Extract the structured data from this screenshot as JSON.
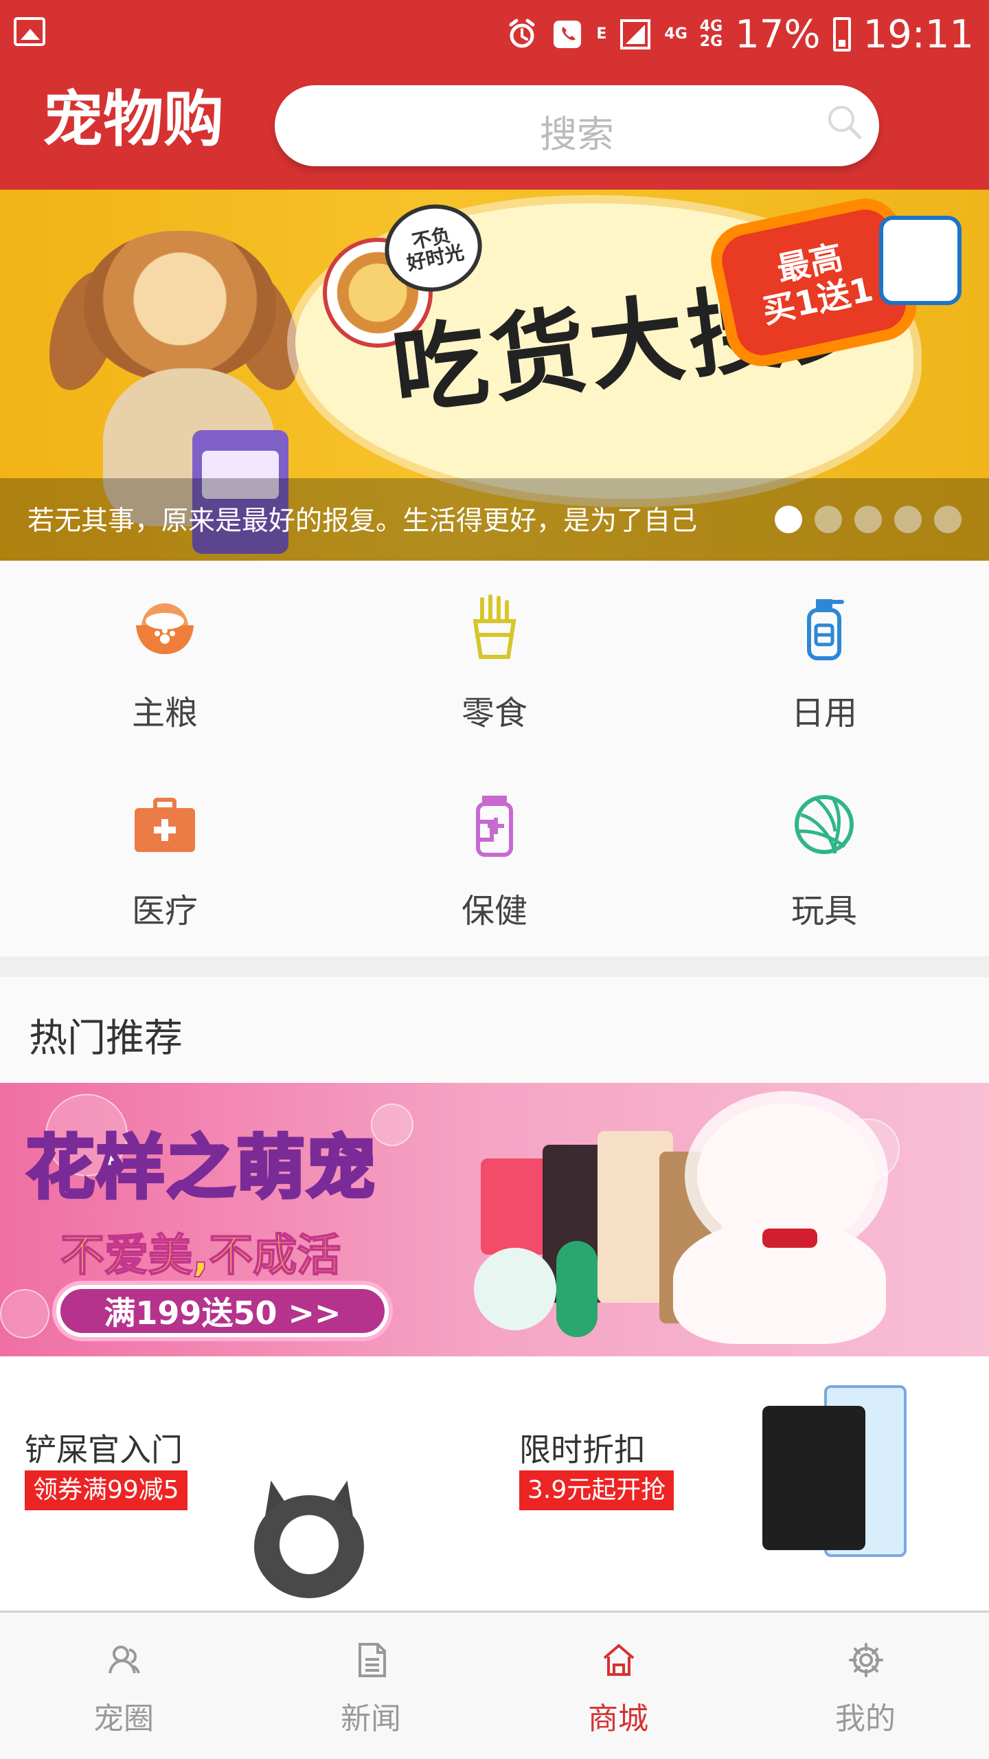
{
  "status_bar": {
    "network_1": "E",
    "network_2": "4G",
    "network_3": "4G",
    "network_4": "2G",
    "battery": "17%",
    "time": "19:11"
  },
  "header": {
    "title": "宠物购",
    "search_placeholder": "搜索"
  },
  "banner": {
    "tag": "不负\n好时光",
    "title": "吃货大搜罗",
    "badge": "最高\n买1送1",
    "caption": "若无其事，原来是最好的报复。生活得更好，是为了自己",
    "dots": [
      "active",
      "inactive",
      "inactive",
      "inactive",
      "inactive"
    ]
  },
  "categories": [
    {
      "label": "主粮",
      "icon": "food-bowl-icon",
      "color": "#ef7e3b"
    },
    {
      "label": "零食",
      "icon": "fries-icon",
      "color": "#d7c62b"
    },
    {
      "label": "日用",
      "icon": "bottle-icon",
      "color": "#2e87d6"
    },
    {
      "label": "医疗",
      "icon": "medical-kit-icon",
      "color": "#eb7c45"
    },
    {
      "label": "保健",
      "icon": "supplement-icon",
      "color": "#c66ad0"
    },
    {
      "label": "玩具",
      "icon": "ball-icon",
      "color": "#30b58a"
    }
  ],
  "hot": {
    "title": "热门推荐",
    "banner_title": "花样之萌宠",
    "banner_subtitle": "不爱美,不成活",
    "banner_button": "满199送50 >>"
  },
  "promos": [
    {
      "title": "铲屎官入门",
      "tag": "领券满99减5"
    },
    {
      "title": "限时折扣",
      "tag": "3.9元起开抢"
    }
  ],
  "bottom_nav": [
    {
      "label": "宠圈",
      "icon": "people-icon",
      "active": false
    },
    {
      "label": "新闻",
      "icon": "news-icon",
      "active": false
    },
    {
      "label": "商城",
      "icon": "home-store-icon",
      "active": true
    },
    {
      "label": "我的",
      "icon": "settings-icon",
      "active": false
    }
  ]
}
